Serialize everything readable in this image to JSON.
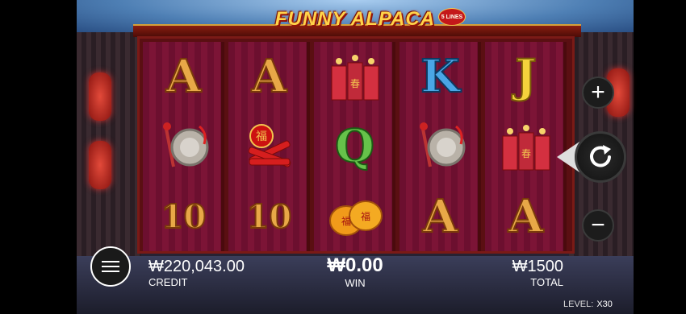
{
  "game": {
    "title": "FUNNY ALPACA",
    "lines_badge": "5 LINES"
  },
  "reels": [
    [
      "A",
      "gong",
      "10"
    ],
    [
      "A",
      "firecrackers-bundle",
      "10"
    ],
    [
      "firecracker-sticks",
      "Q",
      "lucky-bags"
    ],
    [
      "K",
      "gong",
      "A"
    ],
    [
      "J",
      "firecracker-sticks",
      "A"
    ]
  ],
  "controls": {
    "plus": "+",
    "minus": "−",
    "spin_icon": "spin-icon",
    "menu_icon": "menu-icon"
  },
  "stats": {
    "credit_value": "₩220,043.00",
    "credit_label": "CREDIT",
    "win_value": "₩0.00",
    "win_label": "WIN",
    "total_value": "₩1500",
    "total_label": "TOTAL",
    "level_label": "LEVEL:",
    "level_value": "X30"
  }
}
